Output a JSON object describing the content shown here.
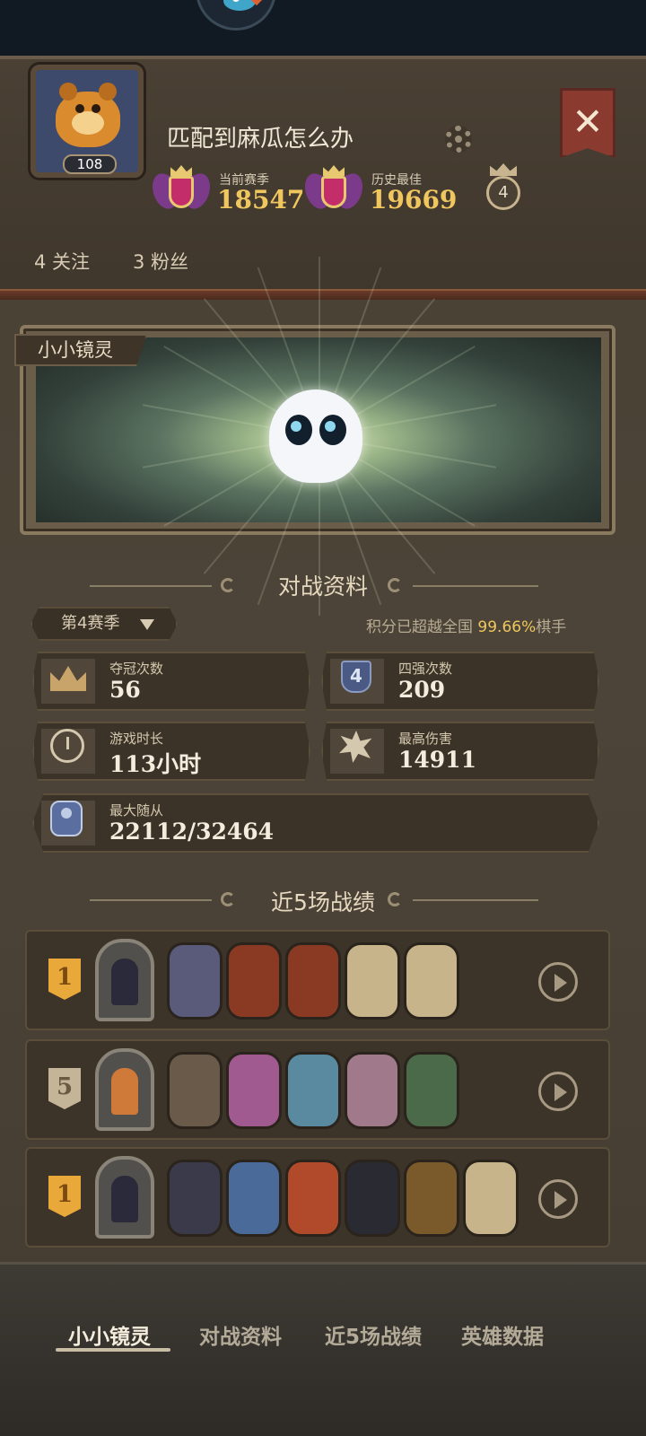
{
  "header": {
    "player_name": "匹配到麻瓜怎么办",
    "level": "108",
    "current_season_label": "当前赛季",
    "current_season_score": "18547",
    "best_label": "历史最佳",
    "best_score": "19669",
    "rank_level": "4",
    "following": "4 关注",
    "followers": "3 粉丝"
  },
  "spirit": {
    "label": "小小镜灵"
  },
  "battle_profile": {
    "title": "对战资料",
    "season_select": "第4赛季",
    "rank_note_prefix": "积分已超越全国 ",
    "rank_note_pct": "99.66%",
    "rank_note_suffix": "棋手",
    "stats": {
      "champion_label": "夺冠次数",
      "champion_value": "56",
      "top4_label": "四强次数",
      "top4_value": "209",
      "top4_icon_text": "4",
      "playtime_label": "游戏时长",
      "playtime_value": "113小时",
      "max_damage_label": "最高伤害",
      "max_damage_value": "14911",
      "max_followers_label": "最大随从",
      "max_followers_value": "22112/32464"
    }
  },
  "recent_matches": {
    "title": "近5场战绩",
    "rows": [
      {
        "place": "1",
        "minions": [
          "#5a5a7a",
          "#8a3a22",
          "#8a3a22",
          "#c8b48a",
          "#c8b48a"
        ]
      },
      {
        "place": "5",
        "minions": [
          "#6a5a4a",
          "#a05a90",
          "#5a8aa0",
          "#a07a8a",
          "#4a6a4a"
        ]
      },
      {
        "place": "1",
        "minions": [
          "#3a3a4a",
          "#4a6a9a",
          "#b04a2a",
          "#2a2a32",
          "#7a5a2a",
          "#c8b48a"
        ]
      }
    ]
  },
  "tabs": {
    "spirit": "小小镜灵",
    "battle": "对战资料",
    "recent": "近5场战绩",
    "heroes": "英雄数据"
  },
  "colors": {
    "gold": "#f0c75e",
    "panel": "#4b4236",
    "close": "#8b3a30"
  }
}
